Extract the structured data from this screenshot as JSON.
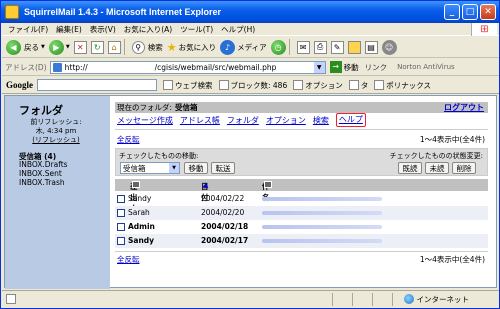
{
  "window": {
    "title": "SquirrelMail 1.4.3 - Microsoft Internet Explorer",
    "minimize": "_",
    "maximize": "□",
    "close": "✕"
  },
  "menu": [
    "ファイル(F)",
    "編集(E)",
    "表示(V)",
    "お気に入り(A)",
    "ツール(T)",
    "ヘルプ(H)"
  ],
  "toolbar": {
    "back": "戻る",
    "search": "検索",
    "favorites": "お気に入り",
    "media": "メディア"
  },
  "address": {
    "label": "アドレス(D)",
    "url_prefix": "http://",
    "url_path": "/cgisis/webmail/src/webmail.php",
    "go": "移動",
    "links": "リンク",
    "norton": "Norton AntiVirus"
  },
  "googlebar": {
    "logo": "Google",
    "web_search": "ウェブ検索",
    "popup_blocked": "ブロック数: 486",
    "options": "オプション",
    "pagerank_short": "タ",
    "popup_short": "ポリナックス"
  },
  "sidebar": {
    "title": "フォルダ",
    "last_refresh_label": "前リフレッシュ:",
    "last_refresh_time": "木, 4:34 pm",
    "refresh_link": "(リフレッシュ)",
    "folders": [
      {
        "label": "受信箱 (4)",
        "bold": true
      },
      {
        "label": "INBOX.Drafts",
        "bold": false
      },
      {
        "label": "INBOX.Sent",
        "bold": false
      },
      {
        "label": "INBOX.Trash",
        "bold": false
      }
    ]
  },
  "main": {
    "current_folder_label": "現在のフォルダ:",
    "current_folder": "受信箱",
    "logout": "ログアウト",
    "nav": [
      "メッセージ作成",
      "アドレス帳",
      "フォルダ",
      "オプション",
      "検索",
      "ヘルプ"
    ],
    "toggle_all": "全反転",
    "count_text": "1～4表示中(全4件)",
    "move_label": "チェックしたものの移動:",
    "status_label": "チェックしたものの状態変更:",
    "move_target": "受信箱",
    "move_button": "移動",
    "forward_button": "転送",
    "read_button": "既読",
    "unread_button": "未読",
    "delete_button": "削除",
    "columns": {
      "from": "差出人",
      "date": "日付",
      "subject": "件名"
    },
    "sort_indicator": "▲",
    "messages": [
      {
        "from": "Sandy",
        "date": "2004/02/22",
        "bold": false
      },
      {
        "from": "Sarah",
        "date": "2004/02/20",
        "bold": false
      },
      {
        "from": "Admin",
        "date": "2004/02/18",
        "bold": true
      },
      {
        "from": "Sandy",
        "date": "2004/02/17",
        "bold": true
      }
    ]
  },
  "status": {
    "zone": "インターネット"
  }
}
